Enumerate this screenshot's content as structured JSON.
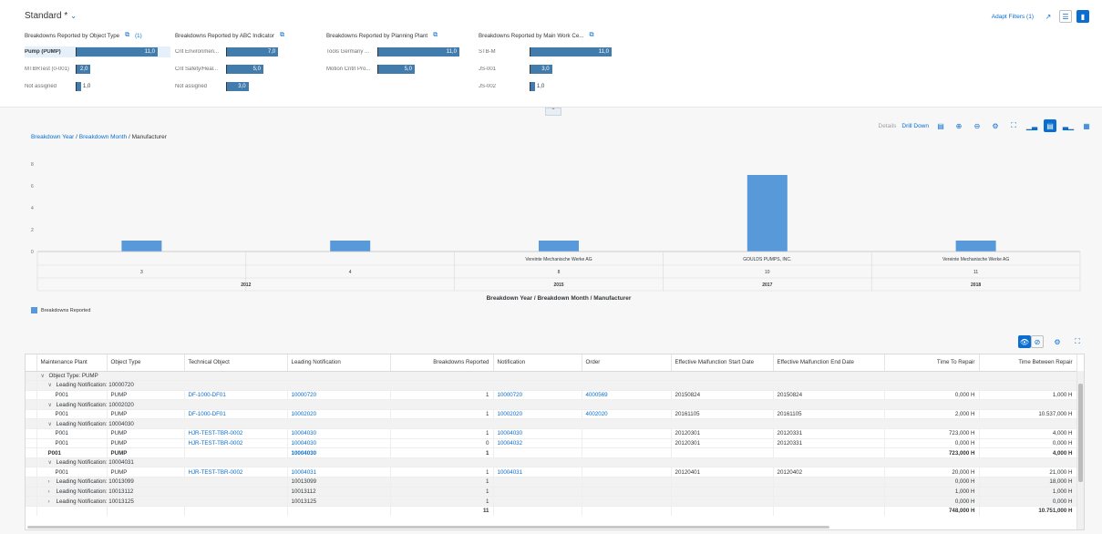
{
  "header": {
    "variant": "Standard *",
    "adapt_filters": "Adapt Filters (1)"
  },
  "cards": [
    {
      "title": "Breakdowns Reported by Object Type",
      "badge": "(1)",
      "max": 11,
      "rows": [
        {
          "label": "Pump (PUMP)",
          "value": 11,
          "display": "11,0",
          "selected": true
        },
        {
          "label": "MTBRTest (0-001)",
          "value": 2,
          "display": "2,0"
        },
        {
          "label": "Not assigned",
          "value": 1,
          "display": "1,0",
          "outside": true
        }
      ]
    },
    {
      "title": "Breakdowns Reported by ABC Indicator",
      "badge": "",
      "max": 11,
      "rows": [
        {
          "label": "Crit Environmen...",
          "value": 7,
          "display": "7,0"
        },
        {
          "label": "Crit Safety/Heal...",
          "value": 5,
          "display": "5,0"
        },
        {
          "label": "Not assigned",
          "value": 3,
          "display": "3,0"
        }
      ]
    },
    {
      "title": "Breakdowns Reported by Planning Plant",
      "badge": "",
      "max": 11,
      "rows": [
        {
          "label": "Tools Germany ...",
          "value": 11,
          "display": "11,0"
        },
        {
          "label": "Motion Cntrl Pro...",
          "value": 5,
          "display": "5,0"
        }
      ]
    },
    {
      "title": "Breakdowns Reported by Main Work Ce...",
      "badge": "",
      "max": 11,
      "rows": [
        {
          "label": "STB-M",
          "value": 11,
          "display": "11,0"
        },
        {
          "label": "JS-001",
          "value": 3,
          "display": "3,0"
        },
        {
          "label": "JS-002",
          "value": 1,
          "display": "1,0",
          "outside": true
        }
      ]
    }
  ],
  "chart_toolbar": {
    "details": "Details",
    "drill_down": "Drill Down"
  },
  "breadcrumb": {
    "level1": "Breakdown Year",
    "level2": "Breakdown Month",
    "level3": "Manufacturer"
  },
  "chart_data": {
    "type": "bar",
    "title": "",
    "xlabel": "Breakdown Year / Breakdown Month / Manufacturer",
    "ylabel": "",
    "ylim": [
      0,
      8
    ],
    "y_ticks": [
      0,
      2,
      4,
      6,
      8
    ],
    "categories": [
      {
        "year": "2012",
        "month": "3",
        "manufacturer": ""
      },
      {
        "year": "2012",
        "month": "4",
        "manufacturer": ""
      },
      {
        "year": "2015",
        "month": "8",
        "manufacturer": "Vereinte Mechanische Werke AG"
      },
      {
        "year": "2017",
        "month": "10",
        "manufacturer": "GOULDS PUMPS, INC."
      },
      {
        "year": "2018",
        "month": "11",
        "manufacturer": "Vereinte Mechanische Werke AG"
      }
    ],
    "series": [
      {
        "name": "Breakdowns Reported",
        "values": [
          1,
          1,
          1,
          7,
          1
        ]
      }
    ],
    "grid": false,
    "legend": "bottom-left",
    "color": "#5899da"
  },
  "table": {
    "columns": [
      "Maintenance Plant",
      "Object Type",
      "Technical Object",
      "Leading Notification",
      "Breakdowns Reported",
      "Notification",
      "Order",
      "Effective Malfunction Start Date",
      "Effective Malfunction End Date",
      "Time To Repair",
      "Time Between Repair"
    ],
    "rows": [
      {
        "kind": "group",
        "level": 0,
        "expanded": true,
        "text": "Object Type: PUMP"
      },
      {
        "kind": "group",
        "level": 1,
        "expanded": true,
        "text": "Leading Notification: 10000720"
      },
      {
        "kind": "data",
        "cells": [
          "P001",
          "PUMP",
          "DF-1000-DF01",
          "10000720",
          "1",
          "10000720",
          "4000569",
          "20150824",
          "20150824",
          "0,000  H",
          "1,000  H"
        ]
      },
      {
        "kind": "group",
        "level": 1,
        "expanded": true,
        "text": "Leading Notification: 10002020"
      },
      {
        "kind": "data",
        "cells": [
          "P001",
          "PUMP",
          "DF-1000-DF01",
          "10002020",
          "1",
          "10002020",
          "4002020",
          "20161105",
          "20161105",
          "2,000  H",
          "10.537,000  H"
        ]
      },
      {
        "kind": "group",
        "level": 1,
        "expanded": true,
        "text": "Leading Notification: 10004030"
      },
      {
        "kind": "data",
        "cells": [
          "P001",
          "PUMP",
          "HJR-TEST-TBR-0002",
          "10004030",
          "1",
          "10004030",
          "",
          "20120301",
          "20120331",
          "723,000  H",
          "4,000  H"
        ]
      },
      {
        "kind": "data",
        "cells": [
          "P001",
          "PUMP",
          "HJR-TEST-TBR-0002",
          "10004030",
          "0",
          "10004032",
          "",
          "20120301",
          "20120331",
          "0,000  H",
          "0,000  H"
        ]
      },
      {
        "kind": "sum",
        "cells": [
          "P001",
          "PUMP",
          "",
          "10004030",
          "1",
          "",
          "",
          "",
          "",
          "723,000  H",
          "4,000  H"
        ]
      },
      {
        "kind": "group",
        "level": 1,
        "expanded": true,
        "text": "Leading Notification: 10004031"
      },
      {
        "kind": "data",
        "cells": [
          "P001",
          "PUMP",
          "HJR-TEST-TBR-0002",
          "10004031",
          "1",
          "10004031",
          "",
          "20120401",
          "20120402",
          "20,000  H",
          "21,000  H"
        ]
      },
      {
        "kind": "cgroup",
        "text": "Leading Notification: 10013099",
        "cells": [
          "",
          "",
          "",
          "10013099",
          "1",
          "",
          "",
          "",
          "",
          "0,000  H",
          "18,000  H"
        ]
      },
      {
        "kind": "cgroup",
        "text": "Leading Notification: 10013112",
        "cells": [
          "",
          "",
          "",
          "10013112",
          "1",
          "",
          "",
          "",
          "",
          "1,000  H",
          "1,000  H"
        ]
      },
      {
        "kind": "cgroup",
        "text": "Leading Notification: 10013125",
        "cells": [
          "",
          "",
          "",
          "10013125",
          "1",
          "",
          "",
          "",
          "",
          "0,000  H",
          "0,000  H"
        ]
      },
      {
        "kind": "total",
        "cells": [
          "",
          "",
          "",
          "",
          "11",
          "",
          "",
          "",
          "",
          "748,000  H",
          "10.751,000  H"
        ]
      }
    ]
  }
}
